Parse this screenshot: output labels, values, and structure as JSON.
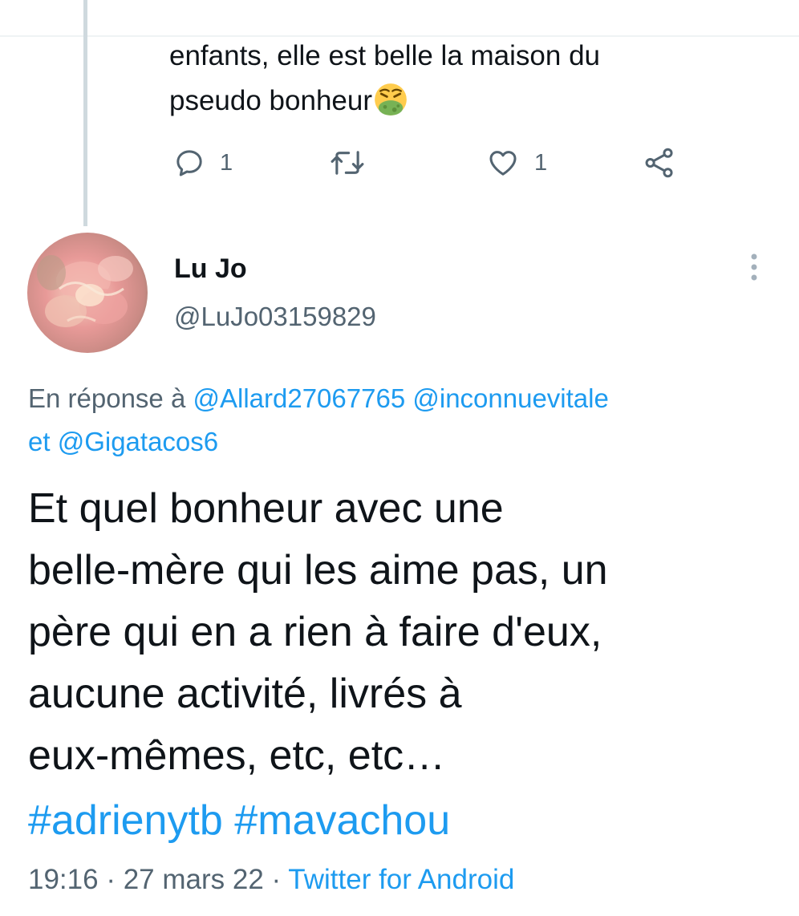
{
  "previous_tweet": {
    "text": "enfants, elle est belle la maison du\npseudo bonheur",
    "emoji_icon": "nauseated-face-icon",
    "reply_count": "1",
    "like_count": "1"
  },
  "tweet": {
    "display_name": "Lu Jo",
    "handle": "@LuJo03159829",
    "reply_prefix": "En réponse à",
    "reply_mentions": [
      "@Allard27067765",
      "@inconnuevitale"
    ],
    "reply_and": "et",
    "reply_last_mention": "@Gigatacos6",
    "text": "Et quel bonheur avec une\nbelle-mère qui les aime pas, un\npère qui en a rien à faire d'eux,\naucune activité, livrés à\neux-mêmes, etc, etc…",
    "hashtags": [
      "#adrienytb",
      "#mavachou"
    ],
    "time": "19:16",
    "separator": " · ",
    "date": "27 mars 22",
    "source": "Twitter for Android"
  },
  "colors": {
    "accent": "#1d9bf0",
    "text": "#0f1419",
    "secondary": "#536471",
    "thread_line": "#cfd9de"
  }
}
